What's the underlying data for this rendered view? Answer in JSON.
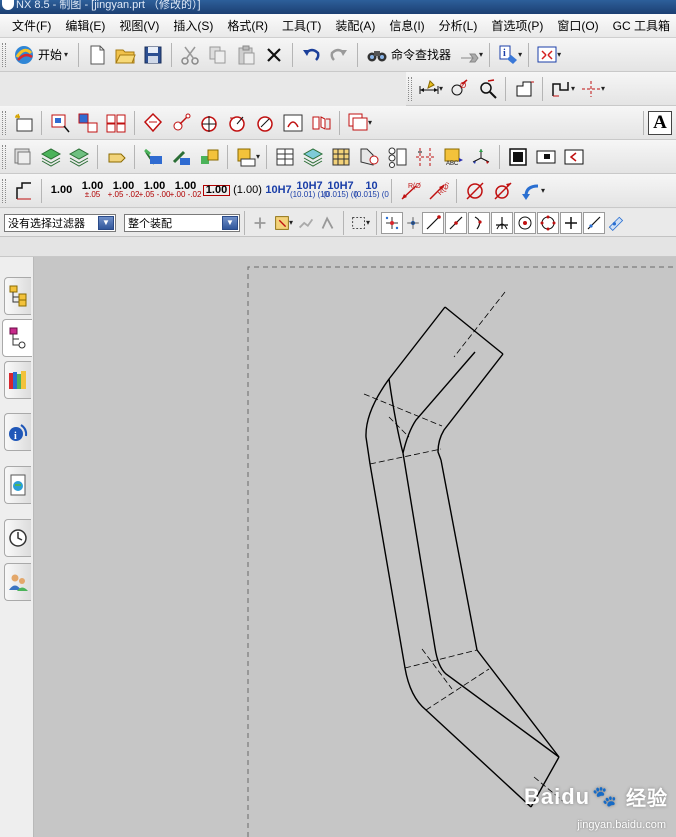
{
  "window": {
    "title": "NX 8.5 - 制图 - [jingyan.prt （修改的）]"
  },
  "menu": {
    "items": [
      "文件(F)",
      "编辑(E)",
      "视图(V)",
      "插入(S)",
      "格式(R)",
      "工具(T)",
      "装配(A)",
      "信息(I)",
      "分析(L)",
      "首选项(P)",
      "窗口(O)",
      "GC 工具箱"
    ]
  },
  "toolbar": {
    "start_label": "开始",
    "command_finder_label": "命令查找器",
    "dimension_styles": [
      {
        "main": "1.00",
        "sub": ""
      },
      {
        "main": "1.00",
        "sub": "±.05"
      },
      {
        "main": "1.00",
        "sub": "+.05 -.02"
      },
      {
        "main": "1.00",
        "sub": "+.05 -.00"
      },
      {
        "main": "1.00",
        "sub": "+.00 -.02"
      },
      {
        "main": "1.00",
        "sub": ""
      },
      {
        "main": "(1.00)",
        "sub": ""
      },
      {
        "main": "10H7",
        "sub": ""
      },
      {
        "main": "10H7",
        "sub": "(10.01) (10"
      },
      {
        "main": "10H7",
        "sub": "(0.015) (0"
      },
      {
        "main": "10",
        "sub": "(0.015) (0"
      }
    ],
    "text_icon_label": "A"
  },
  "selection_bar": {
    "filter_value": "没有选择过滤器",
    "scope_value": "整个装配"
  },
  "watermark": {
    "brand": "Baidu",
    "cn": "经验",
    "url": "jingyan.baidu.com"
  },
  "colors": {
    "canvas": "#c6c6c6",
    "title_bar": "#1c3f72",
    "drawing_line": "#000000"
  }
}
